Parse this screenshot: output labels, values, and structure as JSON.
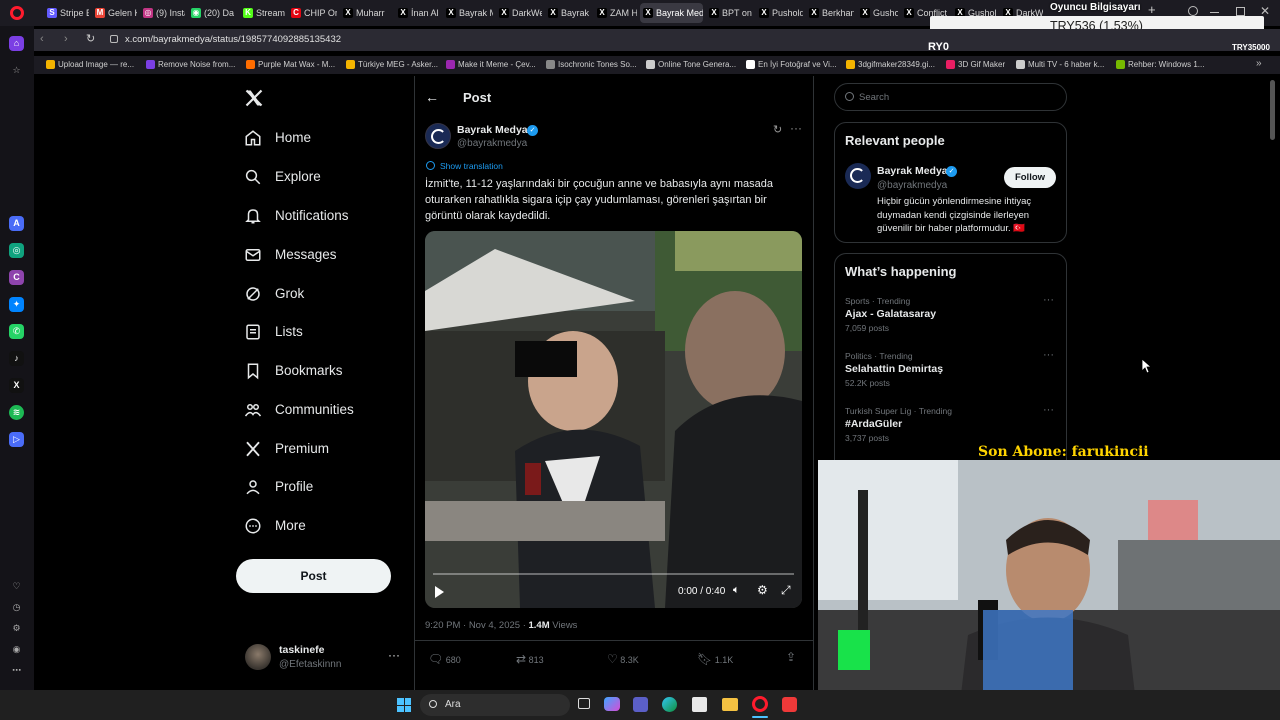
{
  "browser": {
    "tabs": [
      {
        "label": "Stripe E",
        "fav": "S",
        "color": "#635bff"
      },
      {
        "label": "Gelen K",
        "fav": "M",
        "color": "#ea4335"
      },
      {
        "label": "(9) Insta",
        "fav": "◎",
        "color": "#c13584"
      },
      {
        "label": "(20) Da",
        "fav": "◉",
        "color": "#25d366"
      },
      {
        "label": "Stream",
        "fav": "K",
        "color": "#53fc18"
      },
      {
        "label": "CHIP Or",
        "fav": "C",
        "color": "#e30613"
      },
      {
        "label": "Muharr",
        "fav": "X",
        "color": "#000000"
      },
      {
        "label": "İnan Al",
        "fav": "X",
        "color": "#000000"
      },
      {
        "label": "Bayrak M",
        "fav": "X",
        "color": "#000000"
      },
      {
        "label": "DarkWe",
        "fav": "X",
        "color": "#000000"
      },
      {
        "label": "Bayrak M",
        "fav": "X",
        "color": "#000000"
      },
      {
        "label": "ZAM Ha",
        "fav": "X",
        "color": "#000000"
      },
      {
        "label": "Bayrak Medya",
        "fav": "X",
        "color": "#000000"
      },
      {
        "label": "BPT on",
        "fav": "X",
        "color": "#000000"
      },
      {
        "label": "Pushold",
        "fav": "X",
        "color": "#000000"
      },
      {
        "label": "Berkhan",
        "fav": "X",
        "color": "#000000"
      },
      {
        "label": "Gushold",
        "fav": "X",
        "color": "#000000"
      },
      {
        "label": "Conflict",
        "fav": "X",
        "color": "#000000"
      },
      {
        "label": "Gushol",
        "fav": "X",
        "color": "#000000"
      },
      {
        "label": "DarkWe",
        "fav": "X",
        "color": "#000000"
      }
    ],
    "url": "x.com/bayrakmedya/status/1985774092885135432",
    "bookmarks": [
      {
        "label": "Upload Image — re...",
        "color": "#f4b400"
      },
      {
        "label": "Remove Noise from...",
        "color": "#7b3fe4"
      },
      {
        "label": "Purple Mat Wax - M...",
        "color": "#ff6d00"
      },
      {
        "label": "Türkiye MEG - Asker...",
        "color": "#f4b400"
      },
      {
        "label": "Make it Meme - Çev...",
        "color": "#9c27b0"
      },
      {
        "label": "Isochronic Tones So...",
        "color": "#888888"
      },
      {
        "label": "Online Tone Genera...",
        "color": "#cccccc"
      },
      {
        "label": "En İyi Fotoğraf ve Vi...",
        "color": "#ffffff"
      },
      {
        "label": "3dgifmaker28349.gi...",
        "color": "#f4b400"
      },
      {
        "label": "3D Gif Maker",
        "color": "#e91e63"
      },
      {
        "label": "Multi TV - 6 haber k...",
        "color": "#cccccc"
      },
      {
        "label": "Rehber: Windows 1...",
        "color": "#76b900"
      }
    ]
  },
  "overlay": {
    "currency": "TRY536 (1.53%)",
    "player_title": "Oyuncu Bilgisayarı",
    "ticker_left": "RY0",
    "ticker_right": "TRY35000",
    "last_sub": "Son Abone: farukincii"
  },
  "nav": {
    "items": [
      {
        "label": "Home",
        "icon": "home-icon"
      },
      {
        "label": "Explore",
        "icon": "search-icon"
      },
      {
        "label": "Notifications",
        "icon": "bell-icon"
      },
      {
        "label": "Messages",
        "icon": "envelope-icon"
      },
      {
        "label": "Grok",
        "icon": "grok-icon"
      },
      {
        "label": "Lists",
        "icon": "list-icon"
      },
      {
        "label": "Bookmarks",
        "icon": "bookmark-icon"
      },
      {
        "label": "Communities",
        "icon": "people-icon"
      },
      {
        "label": "Premium",
        "icon": "x-logo-icon"
      },
      {
        "label": "Profile",
        "icon": "person-icon"
      },
      {
        "label": "More",
        "icon": "more-circle-icon"
      }
    ],
    "post_label": "Post",
    "account": {
      "name": "taskinefe",
      "handle": "@Efetaskinnn"
    }
  },
  "post": {
    "header": "Post",
    "author": "Bayrak Medya",
    "handle": "@bayrakmedya",
    "translate": "Show translation",
    "text": "İzmit'te, 11-12 yaşlarındaki bir çocuğun anne ve babasıyla aynı masada oturarken rahatlıkla sigara içip çay yudumlaması, görenleri şaşırtan bir görüntü olarak kaydedildi.",
    "video_time": "0:00 / 0:40",
    "video_progress": 0.0,
    "meta_date": "9:20 PM · Nov 4, 2025 · ",
    "views_count": "1.4M",
    "views_label": " Views",
    "replies": "680",
    "reposts": "813",
    "likes": "8.3K",
    "bookmarks": "1.1K"
  },
  "sidebar": {
    "search_placeholder": "Search",
    "relevant_title": "Relevant people",
    "person": {
      "name": "Bayrak Medya",
      "handle": "@bayrakmedya",
      "follow": "Follow",
      "bio": "Hiçbir gücün yönlendirmesine ihtiyaç duymadan kendi çizgisinde ilerleyen güvenilir bir haber platformudur. 🇹🇷"
    },
    "happening_title": "What’s happening",
    "trends": [
      {
        "context": "Sports · Trending",
        "name": "Ajax - Galatasaray",
        "posts": "7,059 posts"
      },
      {
        "context": "Politics · Trending",
        "name": "Selahattin Demirtaş",
        "posts": "52.2K posts"
      },
      {
        "context": "Turkish Super Lig · Trending",
        "name": "#ArdaGüler",
        "posts": "3,737 posts"
      }
    ]
  },
  "taskbar": {
    "search_label": "Ara"
  },
  "colors": {
    "accent": "#1d9bf0",
    "bg": "#000000",
    "border": "#2f3336",
    "muted": "#71767b",
    "overlay_yellow": "#ffd400"
  }
}
